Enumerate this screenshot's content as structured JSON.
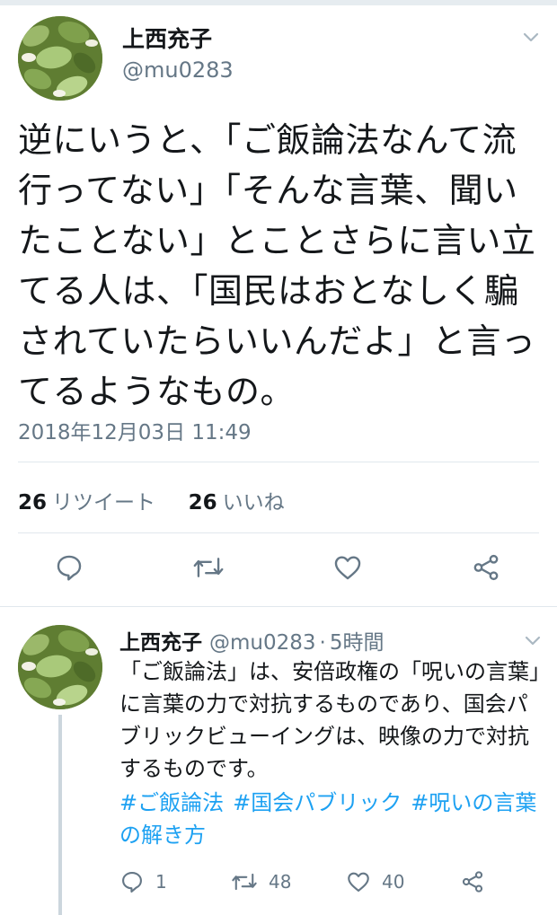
{
  "main_tweet": {
    "author_name": "上西充子",
    "author_handle": "@mu0283",
    "text": "逆にいうと、「ご飯論法なんて流行ってない」「そんな言葉、聞いたことない」とことさらに言い立てる人は、「国民はおとなしく騙されていたらいいんだよ」と言ってるようなもの。",
    "timestamp": "2018年12月03日 11:49",
    "retweets": {
      "count": "26",
      "label": "リツイート"
    },
    "likes": {
      "count": "26",
      "label": "いいね"
    },
    "actions": [
      "reply-icon",
      "retweet-icon",
      "like-icon",
      "share-icon"
    ]
  },
  "reply_tweet": {
    "author_name": "上西充子",
    "author_handle": "@mu0283",
    "separator": "·",
    "time": "5時間",
    "text": "「ご飯論法」は、安倍政権の「呪いの言葉」に言葉の力で対抗するものであり、国会パブリックビューイングは、映像の力で対抗するものです。",
    "hashtags": [
      "#ご飯論法",
      "#国会パブリック",
      "#呪いの言葉の解き方"
    ],
    "reply_count": "1",
    "retweet_count": "48",
    "like_count": "40"
  },
  "colors": {
    "text": "#14171a",
    "secondary": "#657786",
    "link": "#1da1f2",
    "divider": "#e1e8ed",
    "thread_line": "#ccd6dd"
  }
}
